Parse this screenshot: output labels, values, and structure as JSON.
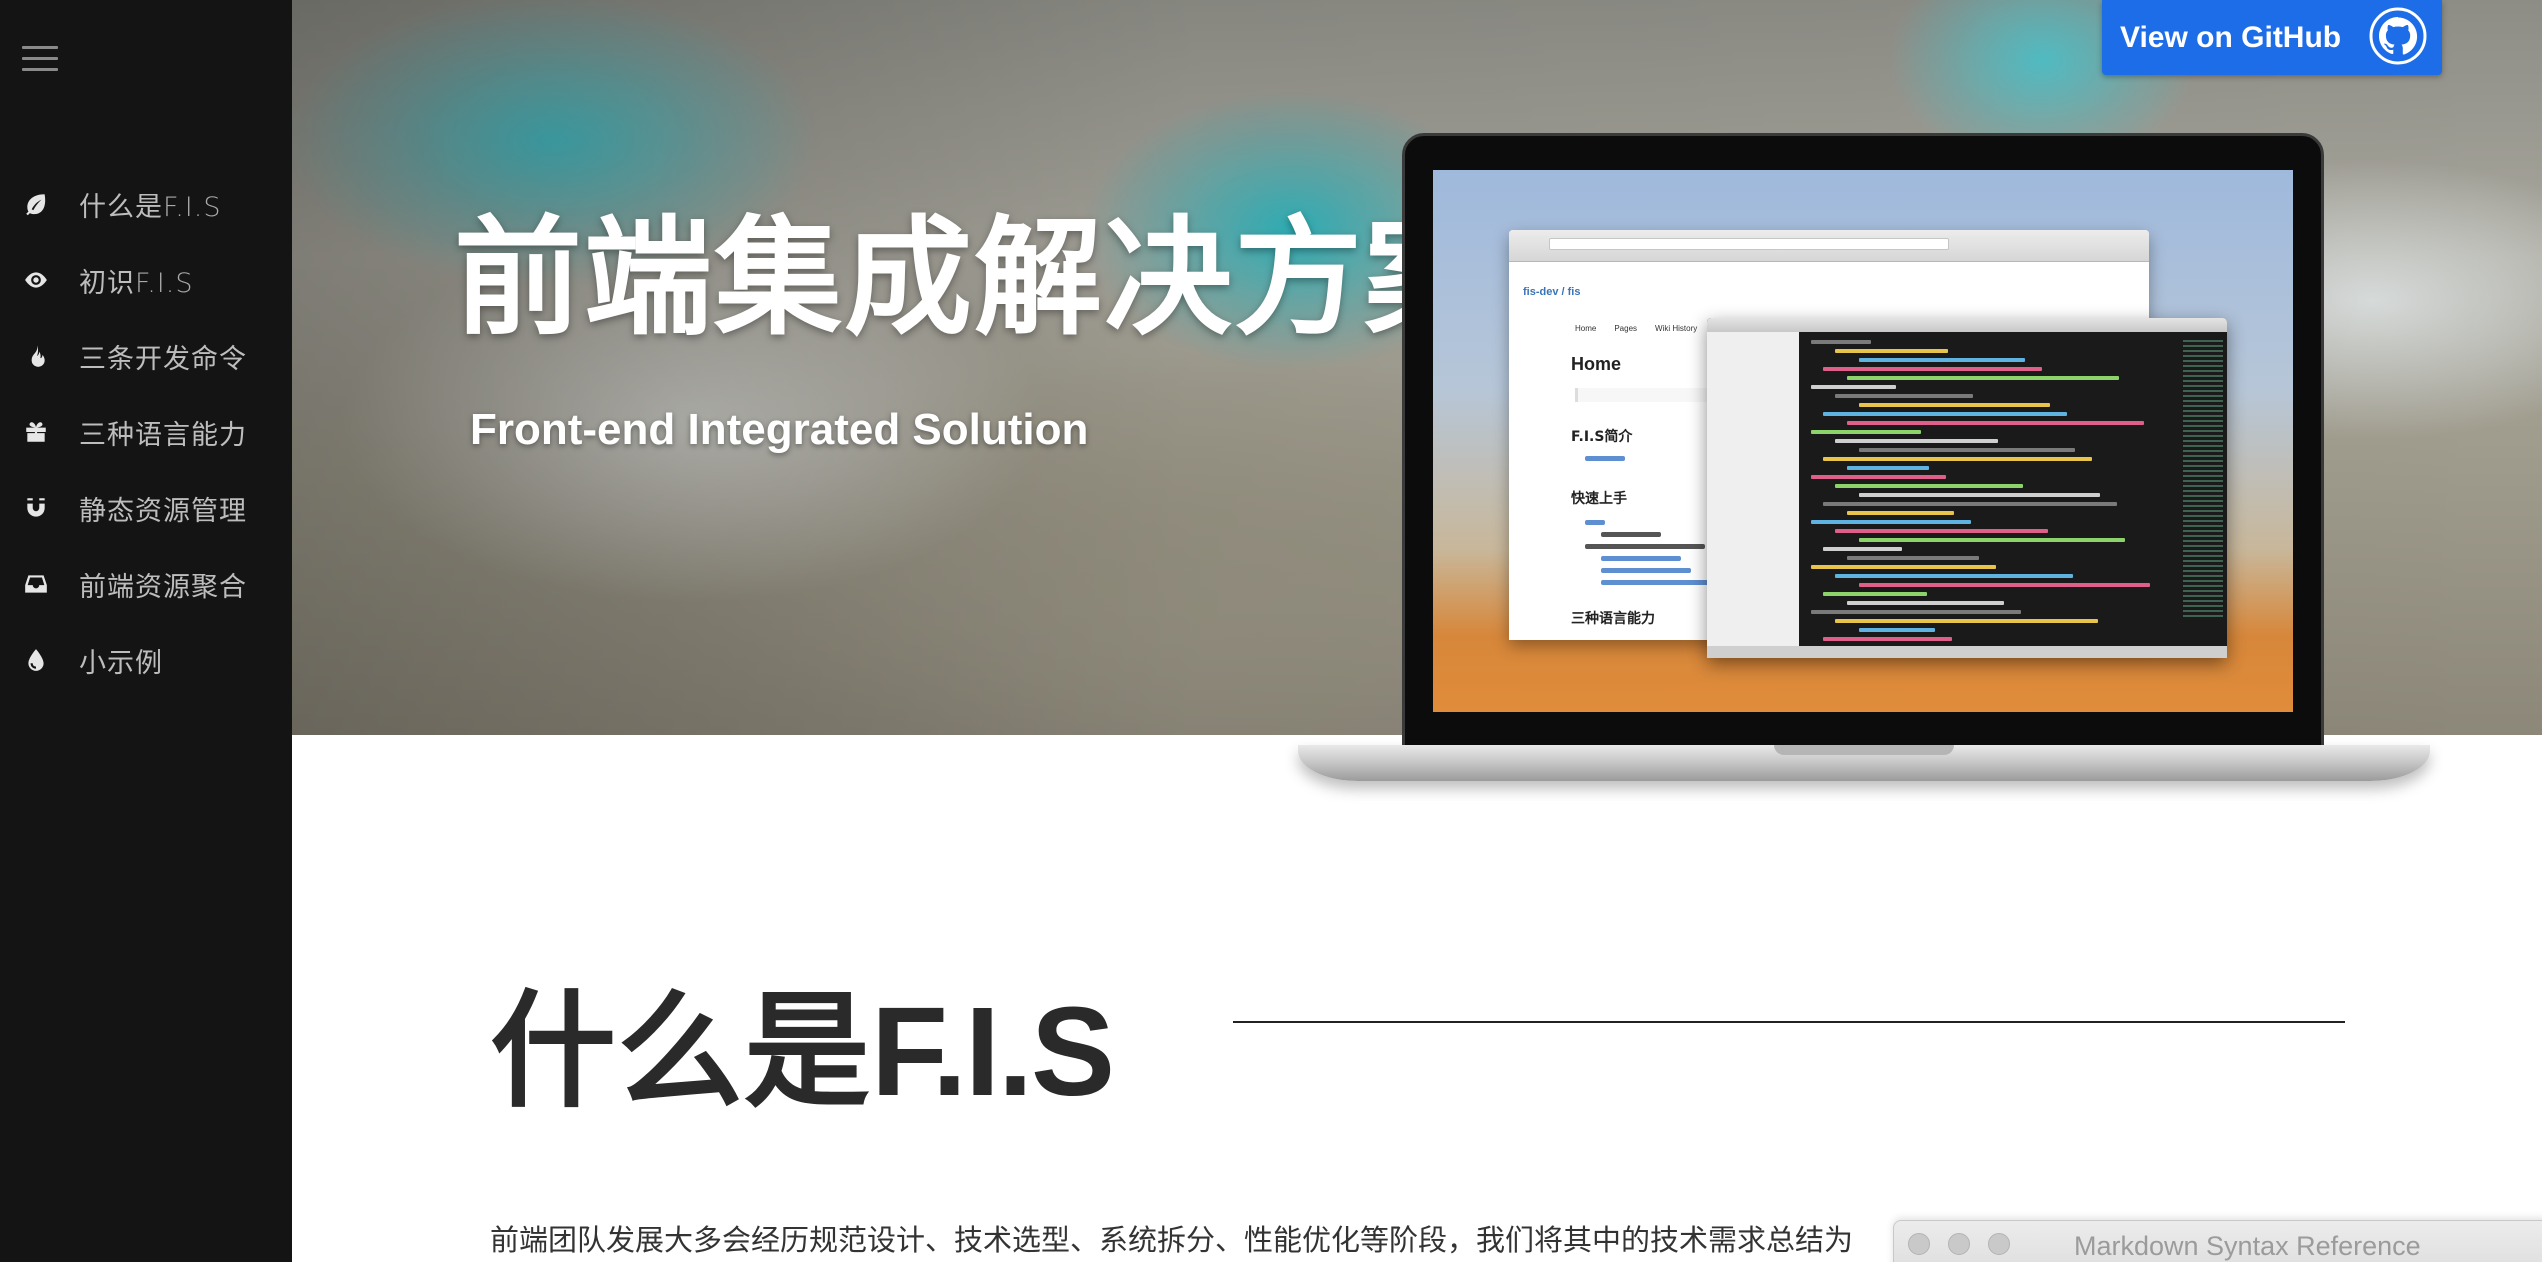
{
  "sidebar": {
    "items": [
      {
        "label_cn": "什么是",
        "label_latin": "F.I.S",
        "icon": "leaf-icon"
      },
      {
        "label_cn": "初识",
        "label_latin": "F.I.S",
        "icon": "eye-icon"
      },
      {
        "label_cn": "三条开发命令",
        "label_latin": "",
        "icon": "flame-icon"
      },
      {
        "label_cn": "三种语言能力",
        "label_latin": "",
        "icon": "gift-icon"
      },
      {
        "label_cn": "静态资源管理",
        "label_latin": "",
        "icon": "magnet-icon"
      },
      {
        "label_cn": "前端资源聚合",
        "label_latin": "",
        "icon": "inbox-icon"
      },
      {
        "label_cn": "小示例",
        "label_latin": "",
        "icon": "droplet-icon"
      }
    ]
  },
  "hero": {
    "title": "前端集成解决方案",
    "subtitle": "Front-end Integrated Solution"
  },
  "github": {
    "label": "View on GitHub",
    "color": "#1e6de8"
  },
  "screen": {
    "repo": "fis-dev / fis",
    "tabs": [
      "Home",
      "Pages",
      "Wiki History"
    ],
    "home": "Home",
    "intro_heading": "F.I.S简介",
    "quickstart_heading": "快速上手",
    "lang_heading": "三种语言能力"
  },
  "section": {
    "title_cn": "什么是",
    "title_latin": "F.I.S",
    "text": "前端团队发展大多会经历规范设计、技术选型、系统拆分、性能优化等阶段，我们将其中的技术需求总结为"
  },
  "md_window": {
    "title": "Markdown Syntax Reference"
  },
  "colors": {
    "sidebar_bg": "#141414",
    "accent": "#1e6de8"
  }
}
